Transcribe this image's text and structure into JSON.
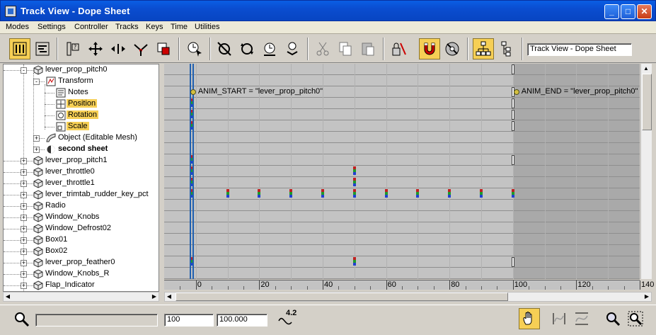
{
  "window": {
    "title": "Track View - Dope Sheet",
    "buttons": {
      "minimize": "_",
      "maximize": "□",
      "close": "✕"
    }
  },
  "menu": [
    "Modes",
    "Settings",
    "Controller",
    "Tracks",
    "Keys",
    "Time",
    "Utilities"
  ],
  "toolbar": {
    "view_name": "Track View - Dope Sheet",
    "buttons": [
      {
        "name": "edit-keys-icon",
        "active": true
      },
      {
        "name": "edit-ranges-icon",
        "active": false
      },
      {
        "name": "filters-icon",
        "active": false
      },
      {
        "name": "move-keys-icon",
        "active": false
      },
      {
        "name": "slide-keys-icon",
        "active": false
      },
      {
        "name": "add-keys-icon",
        "active": false
      },
      {
        "name": "scale-keys-icon",
        "active": false
      },
      {
        "name": "select-time-icon",
        "active": false
      },
      {
        "name": "delete-time-icon",
        "active": false
      },
      {
        "name": "reverse-time-icon",
        "active": false
      },
      {
        "name": "scale-time-icon",
        "active": false
      },
      {
        "name": "insert-time-icon",
        "active": false
      },
      {
        "name": "cut-icon",
        "active": false
      },
      {
        "name": "copy-icon",
        "active": false
      },
      {
        "name": "paste-icon",
        "active": false
      },
      {
        "name": "lock-selection-icon",
        "active": false
      },
      {
        "name": "snap-frames-icon",
        "active": true
      },
      {
        "name": "show-keyable-icon",
        "active": false
      },
      {
        "name": "modify-subtree-icon",
        "active": true
      },
      {
        "name": "modify-child-keys-icon",
        "active": false
      }
    ]
  },
  "hierarchy": [
    {
      "label": "lever_prop_pitch0",
      "level": 0,
      "expander": "-",
      "icon": "object",
      "bold": false,
      "highlight": false
    },
    {
      "label": "Transform",
      "level": 1,
      "expander": "-",
      "icon": "transform",
      "bold": false,
      "highlight": false
    },
    {
      "label": "Notes",
      "level": 2,
      "expander": "",
      "icon": "notes",
      "bold": false,
      "highlight": false
    },
    {
      "label": "Position",
      "level": 2,
      "expander": "",
      "icon": "position",
      "bold": false,
      "highlight": true
    },
    {
      "label": "Rotation",
      "level": 2,
      "expander": "",
      "icon": "rotation",
      "bold": false,
      "highlight": true
    },
    {
      "label": "Scale",
      "level": 2,
      "expander": "",
      "icon": "scale",
      "bold": false,
      "highlight": true
    },
    {
      "label": "Object (Editable Mesh)",
      "level": 1,
      "expander": "+",
      "icon": "mesh",
      "bold": false,
      "highlight": false
    },
    {
      "label": "second sheet",
      "level": 1,
      "expander": "+",
      "icon": "sphere",
      "bold": true,
      "highlight": false
    },
    {
      "label": "lever_prop_pitch1",
      "level": 0,
      "expander": "+",
      "icon": "object",
      "bold": false,
      "highlight": false
    },
    {
      "label": "lever_throttle0",
      "level": 0,
      "expander": "+",
      "icon": "object",
      "bold": false,
      "highlight": false
    },
    {
      "label": "lever_throttle1",
      "level": 0,
      "expander": "+",
      "icon": "object",
      "bold": false,
      "highlight": false
    },
    {
      "label": "lever_trimtab_rudder_key_pct",
      "level": 0,
      "expander": "+",
      "icon": "object",
      "bold": false,
      "highlight": false
    },
    {
      "label": "Radio",
      "level": 0,
      "expander": "+",
      "icon": "object",
      "bold": false,
      "highlight": false
    },
    {
      "label": "Window_Knobs",
      "level": 0,
      "expander": "+",
      "icon": "object",
      "bold": false,
      "highlight": false
    },
    {
      "label": "Window_Defrost02",
      "level": 0,
      "expander": "+",
      "icon": "object",
      "bold": false,
      "highlight": false
    },
    {
      "label": "Box01",
      "level": 0,
      "expander": "+",
      "icon": "object",
      "bold": false,
      "highlight": false
    },
    {
      "label": "Box02",
      "level": 0,
      "expander": "+",
      "icon": "object",
      "bold": false,
      "highlight": false
    },
    {
      "label": "lever_prop_feather0",
      "level": 0,
      "expander": "+",
      "icon": "object",
      "bold": false,
      "highlight": false
    },
    {
      "label": "Window_Knobs_R",
      "level": 0,
      "expander": "+",
      "icon": "object",
      "bold": false,
      "highlight": false
    },
    {
      "label": "Flap_Indicator",
      "level": 0,
      "expander": "+",
      "icon": "object",
      "bold": false,
      "highlight": false
    }
  ],
  "dope_sheet": {
    "frame_start": -10,
    "frame_end": 140,
    "range_end": 100,
    "current_frames": [
      -2,
      -1
    ],
    "notes": [
      {
        "row": 2,
        "frame": -2,
        "text": "ANIM_START = \"lever_prop_pitch0\""
      },
      {
        "row": 2,
        "frame": 100,
        "text": "ANIM_END = \"lever_prop_pitch0\""
      }
    ],
    "keys": [
      {
        "row": 3,
        "frames": [
          -1
        ]
      },
      {
        "row": 4,
        "frames": [
          -1
        ]
      },
      {
        "row": 5,
        "frames": [
          -1
        ]
      },
      {
        "row": 8,
        "frames": [
          -1
        ]
      },
      {
        "row": 9,
        "frames": [
          -1,
          50
        ]
      },
      {
        "row": 10,
        "frames": [
          -1,
          50
        ]
      },
      {
        "row": 11,
        "frames": [
          -1,
          10,
          20,
          30,
          40,
          50,
          60,
          70,
          80,
          90,
          100
        ]
      },
      {
        "row": 17,
        "frames": [
          -1,
          50
        ]
      }
    ],
    "range_rows": [
      0,
      2,
      3,
      4,
      5,
      8,
      17
    ],
    "ruler_labels": [
      "0",
      "20",
      "40",
      "60",
      "80",
      "100",
      "120",
      "140"
    ],
    "ruler_frames": [
      0,
      20,
      40,
      60,
      80,
      100,
      120,
      140
    ]
  },
  "status": {
    "input": "",
    "frame": "100",
    "value": "100.000",
    "version": "4.2"
  }
}
